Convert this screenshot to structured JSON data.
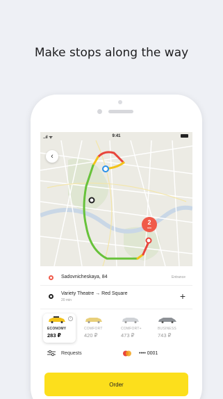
{
  "headline": "Make stops along the way",
  "status_bar": {
    "signal": "..ıl ᯤ",
    "time": "9:41"
  },
  "map": {
    "eta_value": "2",
    "eta_unit": "min",
    "route_colors": {
      "slow": "#e8453c",
      "medium": "#f2c31b",
      "fast": "#67c23a"
    }
  },
  "route": {
    "from": {
      "address": "Sadovnicheskaya, 84",
      "action": "Entrance"
    },
    "to": {
      "label": "Variety Theatre → Red Square",
      "eta": "20 min"
    },
    "add_icon": "+"
  },
  "tariffs": [
    {
      "name": "ECONOMY",
      "price": "283 ₽",
      "selected": true,
      "info_icon": "i"
    },
    {
      "name": "COMFORT",
      "price": "420 ₽",
      "selected": false
    },
    {
      "name": "COMFORT+",
      "price": "473 ₽",
      "selected": false
    },
    {
      "name": "BUSINESS",
      "price": "743 ₽",
      "selected": false
    }
  ],
  "requests": {
    "label": "Requests"
  },
  "payment": {
    "card_number": "•••• 0001"
  },
  "order": {
    "label": "Order"
  },
  "colors": {
    "accent_yellow": "#fcdf1c",
    "eta_badge": "#f05a4a",
    "background": "#eef0f5"
  }
}
